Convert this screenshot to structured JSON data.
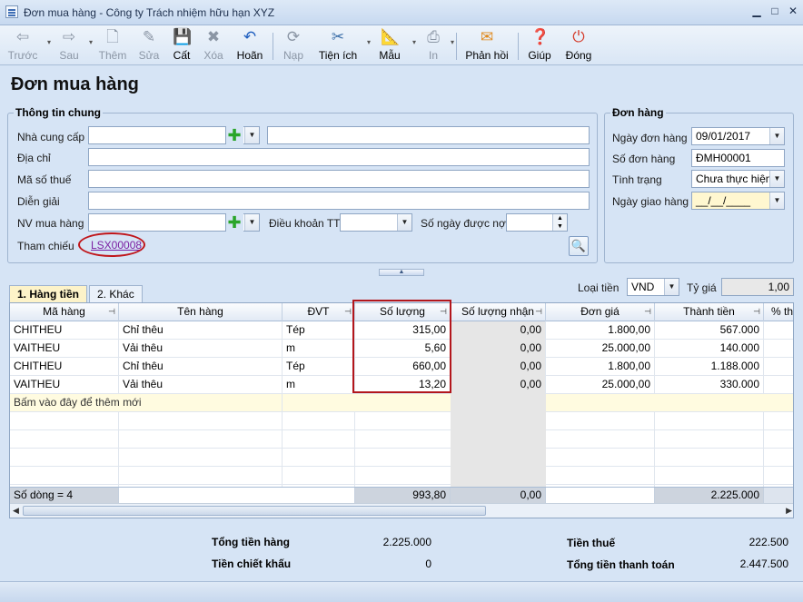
{
  "window": {
    "title": "Đơn mua hàng - Công ty Trách nhiệm hữu hạn XYZ",
    "minimize": "▁",
    "maximize": "□",
    "close": "✕"
  },
  "toolbar": {
    "prev": "Trước",
    "next": "Sau",
    "add": "Thêm",
    "edit": "Sửa",
    "save": "Cất",
    "delete": "Xóa",
    "undo": "Hoãn",
    "post": "Nạp",
    "utilities": "Tiện ích",
    "template": "Mẫu",
    "print": "In",
    "feedback": "Phản hồi",
    "help": "Giúp",
    "close": "Đóng"
  },
  "page_title": "Đơn mua hàng",
  "general": {
    "title": "Thông tin chung",
    "supplier_label": "Nhà cung cấp",
    "supplier_code": "",
    "supplier_name": "",
    "address_label": "Địa chỉ",
    "address": "",
    "tax_label": "Mã số thuế",
    "tax": "",
    "desc_label": "Diễn giải",
    "desc": "",
    "buyer_label": "NV mua hàng",
    "buyer": "",
    "terms_label": "Điều khoản TT",
    "terms": "",
    "credit_days_label": "Số ngày được nợ",
    "credit_days": "",
    "ref_label": "Tham chiếu",
    "ref_link": "LSX00008"
  },
  "order": {
    "title": "Đơn hàng",
    "date_label": "Ngày đơn hàng",
    "date": "09/01/2017",
    "number_label": "Số đơn hàng",
    "number": "ĐMH00001",
    "status_label": "Tình trạng",
    "status": "Chưa thực hiện",
    "delivery_label": "Ngày giao hàng",
    "delivery": "__/__/____"
  },
  "tabs": {
    "items": "1. Hàng tiền",
    "other": "2. Khác"
  },
  "currency": {
    "label": "Loại tiền",
    "value": "VND",
    "rate_label": "Tỷ giá",
    "rate": "1,00"
  },
  "grid": {
    "headers": [
      "Mã hàng",
      "Tên hàng",
      "ĐVT",
      "Số lượng",
      "Số lượng nhận",
      "Đơn giá",
      "Thành tiền",
      "% thu"
    ],
    "rows": [
      [
        "CHITHEU",
        "Chỉ thêu",
        "Tép",
        "315,00",
        "0,00",
        "1.800,00",
        "567.000"
      ],
      [
        "VAITHEU",
        "Vải thêu",
        "m",
        "5,60",
        "0,00",
        "25.000,00",
        "140.000"
      ],
      [
        "CHITHEU",
        "Chỉ thêu",
        "Tép",
        "660,00",
        "0,00",
        "1.800,00",
        "1.188.000"
      ],
      [
        "VAITHEU",
        "Vải thêu",
        "m",
        "13,20",
        "0,00",
        "25.000,00",
        "330.000"
      ]
    ],
    "new_row_hint": "Bấm vào đây để thêm mới",
    "footer": {
      "row_count": "Số dòng = 4",
      "qty_total": "993,80",
      "received_total": "0,00",
      "amount_total": "2.225.000"
    }
  },
  "totals": {
    "goods_label": "Tổng tiền hàng",
    "goods": "2.225.000",
    "discount_label": "Tiền chiết khấu",
    "discount": "0",
    "tax_label": "Tiền thuế",
    "tax": "222.500",
    "payment_label": "Tổng tiền thanh toán",
    "payment": "2.447.500"
  },
  "colors": {
    "background": "#d6e4f5",
    "highlight": "#b3161c",
    "link": "#7b1fa2"
  }
}
